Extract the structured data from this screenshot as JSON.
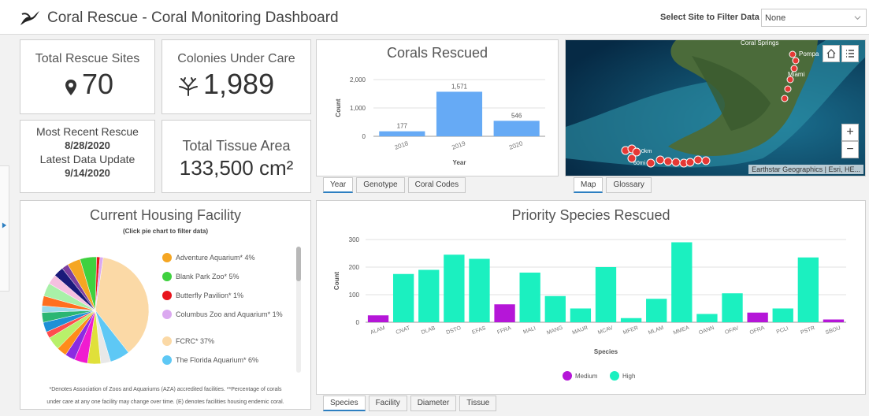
{
  "header": {
    "title": "Coral Rescue - Coral Monitoring Dashboard",
    "filter_label": "Select Site to Filter Data",
    "filter_value": "None"
  },
  "indicators": {
    "sites": {
      "title": "Total Rescue Sites",
      "value": "70",
      "icon": "map-pin-icon"
    },
    "colonies": {
      "title": "Colonies Under Care",
      "value": "1,989",
      "icon": "coral-icon"
    },
    "recent": {
      "rescue_label": "Most Recent Rescue",
      "rescue_date": "8/28/2020",
      "update_label": "Latest Data Update",
      "update_date": "9/14/2020"
    },
    "tissue": {
      "title": "Total Tissue Area",
      "value": "133,500 cm²"
    }
  },
  "corals_rescued": {
    "title": "Corals Rescued",
    "tabs": [
      "Year",
      "Genotype",
      "Coral Codes"
    ],
    "active_tab": 0
  },
  "map": {
    "labels": {
      "coral_springs": "Coral Springs",
      "pompano": "Pompa",
      "miami": "Miami",
      "dist1": "0km",
      "dist2": "60mi"
    },
    "attribution": "Earthstar Geographics | Esri, HE...",
    "tabs": [
      "Map",
      "Glossary"
    ],
    "active_tab": 0,
    "zoom_in": "+",
    "zoom_out": "−"
  },
  "housing": {
    "title": "Current Housing Facility",
    "subtitle": "(Click pie chart to filter data)",
    "footnote1": "*Denotes Association of Zoos and Aquariums (AZA) accredited facilities. **Percentage of corals",
    "footnote2": "under care at any one facility may change over time. (E) denotes facilities housing endemic coral.",
    "legend": [
      {
        "label": "Adventure Aquarium*  4%",
        "color": "#f5a623"
      },
      {
        "label": "Blank Park Zoo*  5%",
        "color": "#3fd13f"
      },
      {
        "label": "Butterfly Pavilion*  1%",
        "color": "#e8141c"
      },
      {
        "label": "Columbus Zoo and Aquarium*  1%",
        "color": "#dba9f0"
      },
      {
        "label": "FCRC*  37%",
        "color": "#fbd9a6"
      },
      {
        "label": "The Florida Aquarium*  6%",
        "color": "#5ec8f5"
      }
    ]
  },
  "priority": {
    "title": "Priority Species Rescued",
    "tabs": [
      "Species",
      "Facility",
      "Diameter",
      "Tissue"
    ],
    "active_tab": 0,
    "legend": [
      {
        "label": "Medium",
        "color": "#b516d8"
      },
      {
        "label": "High",
        "color": "#1bf0c0"
      }
    ]
  },
  "chart_data": [
    {
      "type": "bar",
      "title": "Corals Rescued",
      "categories": [
        "2018",
        "2019",
        "2020"
      ],
      "values": [
        177,
        1571,
        546
      ],
      "data_labels": [
        "177",
        "1,571",
        "546"
      ],
      "xlabel": "Year",
      "ylabel": "Count",
      "ylim": [
        0,
        2000
      ],
      "yticks": [
        "0",
        "1,000",
        "2,000"
      ],
      "color": "#66aaf5"
    },
    {
      "type": "bar",
      "title": "Priority Species Rescued",
      "categories": [
        "ALAM",
        "CNAT",
        "DLAB",
        "DSTO",
        "EFAS",
        "FFRA",
        "MALI",
        "MANG",
        "MAUR",
        "MCAV",
        "MFER",
        "MLAM",
        "MMEA",
        "OANN",
        "OFAV",
        "OFRA",
        "PCLI",
        "PSTR",
        "SBOU"
      ],
      "values": [
        25,
        175,
        190,
        245,
        230,
        65,
        180,
        95,
        50,
        200,
        15,
        85,
        290,
        30,
        105,
        35,
        50,
        235,
        10
      ],
      "priority": [
        "Medium",
        "High",
        "High",
        "High",
        "High",
        "Medium",
        "High",
        "High",
        "High",
        "High",
        "High",
        "High",
        "High",
        "High",
        "High",
        "Medium",
        "High",
        "High",
        "Medium"
      ],
      "xlabel": "Species",
      "ylabel": "Count",
      "ylim": [
        0,
        300
      ],
      "yticks": [
        "0",
        "100",
        "200",
        "300"
      ]
    },
    {
      "type": "pie",
      "title": "Current Housing Facility",
      "slices": [
        {
          "label": "FCRC*",
          "value": 37,
          "color": "#fbd9a6"
        },
        {
          "label": "The Florida Aquarium*",
          "value": 6,
          "color": "#5ec8f5"
        },
        {
          "label": "unlabeled",
          "value": 3,
          "color": "#e8e8e8"
        },
        {
          "label": "unlabeled",
          "value": 4,
          "color": "#e0e03a"
        },
        {
          "label": "unlabeled",
          "value": 4,
          "color": "#f01bd0"
        },
        {
          "label": "unlabeled",
          "value": 3,
          "color": "#8b2be2"
        },
        {
          "label": "unlabeled",
          "value": 3,
          "color": "#ff8c1a"
        },
        {
          "label": "unlabeled",
          "value": 4,
          "color": "#b8f06a"
        },
        {
          "label": "unlabeled",
          "value": 2,
          "color": "#ff4d4d"
        },
        {
          "label": "unlabeled",
          "value": 3,
          "color": "#1e90d6"
        },
        {
          "label": "unlabeled",
          "value": 3,
          "color": "#2bb673"
        },
        {
          "label": "unlabeled",
          "value": 2,
          "color": "#9ad9ea"
        },
        {
          "label": "unlabeled",
          "value": 3,
          "color": "#ff6f1f"
        },
        {
          "label": "unlabeled",
          "value": 4,
          "color": "#a8f0a8"
        },
        {
          "label": "unlabeled",
          "value": 3,
          "color": "#f5c0e0"
        },
        {
          "label": "unlabeled",
          "value": 3,
          "color": "#1a1a7a"
        },
        {
          "label": "unlabeled",
          "value": 2,
          "color": "#7b3fa0"
        },
        {
          "label": "Adventure Aquarium*",
          "value": 4,
          "color": "#f5a623"
        },
        {
          "label": "Blank Park Zoo*",
          "value": 5,
          "color": "#3fd13f"
        },
        {
          "label": "Butterfly Pavilion*",
          "value": 1,
          "color": "#e8141c"
        },
        {
          "label": "Columbus Zoo and Aquarium*",
          "value": 1,
          "color": "#dba9f0"
        }
      ]
    }
  ]
}
